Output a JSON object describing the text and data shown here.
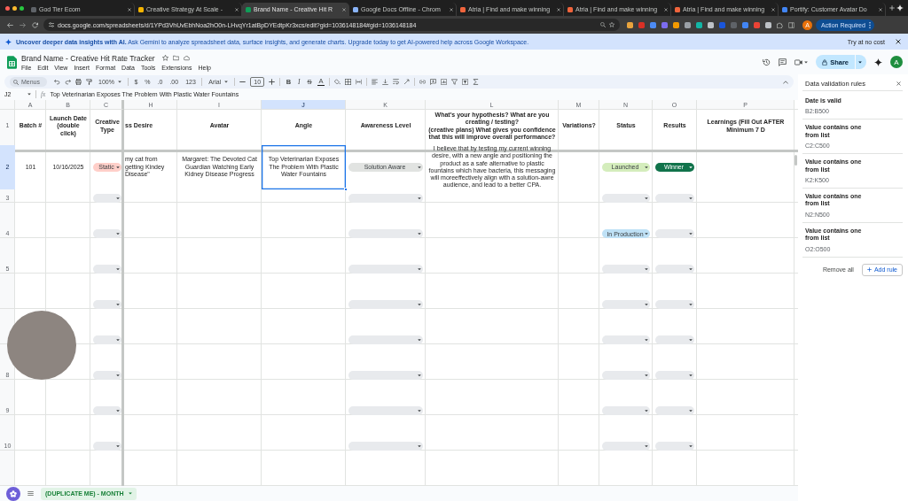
{
  "browser": {
    "tabs": [
      {
        "title": "God Tier Ecom",
        "color": "#5f6368",
        "selected": false
      },
      {
        "title": "Creative Strategy At Scale -",
        "color": "#f4b400",
        "selected": false
      },
      {
        "title": "Brand Name - Creative Hit R",
        "color": "#0f9d58",
        "selected": true
      },
      {
        "title": "Google Docs Offline - Chrom",
        "color": "#8ab4f8",
        "selected": false
      },
      {
        "title": "Atria | Find and make winning",
        "color": "#f0643c",
        "selected": false
      },
      {
        "title": "Atria | Find and make winning",
        "color": "#f0643c",
        "selected": false
      },
      {
        "title": "Atria | Find and make winning",
        "color": "#f0643c",
        "selected": false
      },
      {
        "title": "Portify: Customer Avatar Do",
        "color": "#4285f4",
        "selected": false
      }
    ],
    "url": "docs.google.com/spreadsheets/d/1YPd3VhUvEbhNoa2hO0n-LHvqYr1atBpDYEdtpKr3xcs/edit?gid=1036148184#gid=1036148184",
    "profile": "A",
    "action": "Action Required"
  },
  "banner": {
    "message": "**Uncover deeper data insights with AI.**  Ask Gemini to analyze spreadsheet data, surface insights, and generate charts. Upgrade today to get AI-powered help across Google Workspace.",
    "link": "Try at no cost"
  },
  "document": {
    "title": "Brand Name - Creative Hit Rate Tracker",
    "menu": [
      "File",
      "Edit",
      "View",
      "Insert",
      "Format",
      "Data",
      "Tools",
      "Extensions",
      "Help"
    ],
    "share": "Share",
    "avatar": "A"
  },
  "toolbar": [
    {
      "kind": "search",
      "label": "Menus"
    },
    {
      "kind": "undo"
    },
    {
      "kind": "redo"
    },
    {
      "kind": "print"
    },
    {
      "kind": "paint-format"
    },
    {
      "kind": "dropdown",
      "label": "100%"
    },
    {
      "kind": "separator"
    },
    {
      "kind": "text",
      "label": "$"
    },
    {
      "kind": "text",
      "label": "%"
    },
    {
      "kind": "text",
      "label": ".0"
    },
    {
      "kind": "text",
      "label": ".00"
    },
    {
      "kind": "text",
      "label": "123"
    },
    {
      "kind": "separator"
    },
    {
      "kind": "dropdown",
      "label": "Arial"
    },
    {
      "kind": "separator"
    },
    {
      "kind": "minus"
    },
    {
      "kind": "field",
      "value": "10"
    },
    {
      "kind": "plus"
    },
    {
      "kind": "separator"
    },
    {
      "kind": "bold",
      "label": "B"
    },
    {
      "kind": "italic",
      "label": "I"
    },
    {
      "kind": "strike",
      "label": "S"
    },
    {
      "kind": "text-color",
      "label": "A"
    },
    {
      "kind": "separator"
    },
    {
      "kind": "fill"
    },
    {
      "kind": "borders"
    },
    {
      "kind": "merge"
    },
    {
      "kind": "separator"
    },
    {
      "kind": "align"
    },
    {
      "kind": "valign"
    },
    {
      "kind": "wrap"
    },
    {
      "kind": "rotate"
    },
    {
      "kind": "separator"
    },
    {
      "kind": "link"
    },
    {
      "kind": "comment"
    },
    {
      "kind": "chart"
    },
    {
      "kind": "filter"
    },
    {
      "kind": "filter-views"
    },
    {
      "kind": "functions"
    }
  ],
  "formula_bar": {
    "cell": "J2",
    "function_label": "fx",
    "formula": "Top Veterinarian Exposes The Problem With Plastic Water Fountains"
  },
  "sheet": {
    "columns": [
      {
        "letter": "A",
        "selected": false
      },
      {
        "letter": "B",
        "selected": false
      },
      {
        "letter": "C",
        "selected": false
      },
      {
        "letter": "H",
        "selected": false
      },
      {
        "letter": "I",
        "selected": false
      },
      {
        "letter": "J",
        "selected": true
      },
      {
        "letter": "K",
        "selected": false
      },
      {
        "letter": "L",
        "selected": false
      },
      {
        "letter": "M",
        "selected": false
      },
      {
        "letter": "N",
        "selected": false
      },
      {
        "letter": "O",
        "selected": false
      },
      {
        "letter": "P",
        "selected": false
      }
    ],
    "rows": [
      {
        "number": "1",
        "selected": false,
        "kind": "header",
        "cells": [
          {
            "kind": "text",
            "text": "Batch #"
          },
          {
            "kind": "text",
            "text": "Launch Date (double click)"
          },
          {
            "kind": "text",
            "text": "Creative Type"
          },
          {
            "kind": "text",
            "text": "ss Desire"
          },
          {
            "kind": "text",
            "text": "Avatar"
          },
          {
            "kind": "text",
            "text": "Angle"
          },
          {
            "kind": "text",
            "text": "Awareness Level"
          },
          {
            "kind": "text",
            "text": "What's your hypothesis? What are you creating / testing?\n(creative plans) What gives you confidence that this will improve overall performance?"
          },
          {
            "kind": "text",
            "text": "Variations?"
          },
          {
            "kind": "text",
            "text": "Status"
          },
          {
            "kind": "text",
            "text": "Results"
          },
          {
            "kind": "text",
            "text": "Learnings (Fill Out AFTER Minimum 7 D"
          }
        ]
      },
      {
        "number": "2",
        "selected": true,
        "kind": "data",
        "cells": [
          {
            "kind": "text",
            "text": "101"
          },
          {
            "kind": "text",
            "text": "10/16/2025"
          },
          {
            "kind": "chip",
            "label": "Static",
            "color": "#ffcfc9"
          },
          {
            "kind": "text",
            "text": "my cat from getting Kindey Disease\""
          },
          {
            "kind": "text",
            "text": "Margaret: The Devoted Cat Guardian Watching Early Kidney Disease Progress"
          },
          {
            "kind": "text",
            "text": "Top Veterinarian Exposes The Problem With Plastic Water Fountains"
          },
          {
            "kind": "chip",
            "label": "Solution Aware",
            "color": "#e1e3e1"
          },
          {
            "kind": "text",
            "text": "I believe that by testing my current winning desire, with a new angle and positioning the product as a safe alternative to plastic fountains which have bacteria, this messaging will moreeffectively align with a solution-awre audience, and lead to a better CPA."
          },
          {
            "kind": "empty"
          },
          {
            "kind": "chip",
            "label": "Launched",
            "color": "#d4edbc"
          },
          {
            "kind": "chip",
            "label": "Winner",
            "color": "#11734b"
          },
          {
            "kind": "empty"
          }
        ]
      },
      {
        "number": "3",
        "selected": false,
        "kind": "data",
        "cells": [
          {
            "kind": "empty"
          },
          {
            "kind": "empty"
          },
          {
            "kind": "chip",
            "color": "#e8eaed"
          },
          {
            "kind": "empty"
          },
          {
            "kind": "empty"
          },
          {
            "kind": "empty"
          },
          {
            "kind": "chip",
            "color": "#e8eaed"
          },
          {
            "kind": "empty"
          },
          {
            "kind": "empty"
          },
          {
            "kind": "chip",
            "color": "#e8eaed"
          },
          {
            "kind": "chip",
            "color": "#e8eaed"
          },
          {
            "kind": "empty"
          }
        ]
      },
      {
        "number": "4",
        "selected": false,
        "kind": "data",
        "cells": [
          {
            "kind": "empty"
          },
          {
            "kind": "empty"
          },
          {
            "kind": "chip",
            "color": "#e8eaed"
          },
          {
            "kind": "empty"
          },
          {
            "kind": "empty"
          },
          {
            "kind": "empty"
          },
          {
            "kind": "chip",
            "color": "#e8eaed"
          },
          {
            "kind": "empty"
          },
          {
            "kind": "empty"
          },
          {
            "kind": "chip",
            "label": "In Production",
            "color": "#bfe1f6"
          },
          {
            "kind": "chip",
            "color": "#e8eaed"
          },
          {
            "kind": "empty"
          }
        ]
      },
      {
        "number": "5",
        "selected": false,
        "kind": "data",
        "cells": [
          {
            "kind": "empty"
          },
          {
            "kind": "empty"
          },
          {
            "kind": "chip",
            "color": "#e8eaed"
          },
          {
            "kind": "empty"
          },
          {
            "kind": "empty"
          },
          {
            "kind": "empty"
          },
          {
            "kind": "chip",
            "color": "#e8eaed"
          },
          {
            "kind": "empty"
          },
          {
            "kind": "empty"
          },
          {
            "kind": "chip",
            "color": "#e8eaed"
          },
          {
            "kind": "chip",
            "color": "#e8eaed"
          },
          {
            "kind": "empty"
          }
        ]
      },
      {
        "selected": false,
        "kind": "data",
        "cells": [
          {
            "kind": "empty"
          },
          {
            "kind": "empty"
          },
          {
            "kind": "chip",
            "color": "#e8eaed"
          },
          {
            "kind": "empty"
          },
          {
            "kind": "empty"
          },
          {
            "kind": "empty"
          },
          {
            "kind": "chip",
            "color": "#e8eaed"
          },
          {
            "kind": "empty"
          },
          {
            "kind": "empty"
          },
          {
            "kind": "chip",
            "color": "#e8eaed"
          },
          {
            "kind": "chip",
            "color": "#e8eaed"
          },
          {
            "kind": "empty"
          }
        ]
      },
      {
        "selected": false,
        "kind": "data",
        "cells": [
          {
            "kind": "empty"
          },
          {
            "kind": "empty"
          },
          {
            "kind": "chip",
            "color": "#e8eaed"
          },
          {
            "kind": "empty"
          },
          {
            "kind": "empty"
          },
          {
            "kind": "empty"
          },
          {
            "kind": "chip",
            "color": "#e8eaed"
          },
          {
            "kind": "empty"
          },
          {
            "kind": "empty"
          },
          {
            "kind": "chip",
            "color": "#e8eaed"
          },
          {
            "kind": "chip",
            "color": "#e8eaed"
          },
          {
            "kind": "empty"
          }
        ]
      },
      {
        "number": "8",
        "selected": false,
        "kind": "data",
        "cells": [
          {
            "kind": "empty"
          },
          {
            "kind": "empty"
          },
          {
            "kind": "chip",
            "color": "#e8eaed"
          },
          {
            "kind": "empty"
          },
          {
            "kind": "empty"
          },
          {
            "kind": "empty"
          },
          {
            "kind": "chip",
            "color": "#e8eaed"
          },
          {
            "kind": "empty"
          },
          {
            "kind": "empty"
          },
          {
            "kind": "chip",
            "color": "#e8eaed"
          },
          {
            "kind": "chip",
            "color": "#e8eaed"
          },
          {
            "kind": "empty"
          }
        ]
      },
      {
        "number": "9",
        "selected": false,
        "kind": "data",
        "cells": [
          {
            "kind": "empty"
          },
          {
            "kind": "empty"
          },
          {
            "kind": "chip",
            "color": "#e8eaed"
          },
          {
            "kind": "empty"
          },
          {
            "kind": "empty"
          },
          {
            "kind": "empty"
          },
          {
            "kind": "chip",
            "color": "#e8eaed"
          },
          {
            "kind": "empty"
          },
          {
            "kind": "empty"
          },
          {
            "kind": "chip",
            "color": "#e8eaed"
          },
          {
            "kind": "chip",
            "color": "#e8eaed"
          },
          {
            "kind": "empty"
          }
        ]
      },
      {
        "number": "10",
        "selected": false,
        "kind": "data",
        "cells": [
          {
            "kind": "empty"
          },
          {
            "kind": "empty"
          },
          {
            "kind": "chip",
            "color": "#e8eaed"
          },
          {
            "kind": "empty"
          },
          {
            "kind": "empty"
          },
          {
            "kind": "empty"
          },
          {
            "kind": "chip",
            "color": "#e8eaed"
          },
          {
            "kind": "empty"
          },
          {
            "kind": "empty"
          },
          {
            "kind": "chip",
            "color": "#e8eaed"
          },
          {
            "kind": "chip",
            "color": "#e8eaed"
          },
          {
            "kind": "empty"
          }
        ]
      }
    ]
  },
  "sheet_tabs": [
    {
      "label": "(DUPLICATE ME) - MONTH",
      "selected": true
    }
  ],
  "panel": {
    "title": "Data validation rules",
    "rules": [
      {
        "condition": "Date is valid",
        "range": "B2:B500"
      },
      {
        "condition": "Value contains one from list",
        "range": "C2:C500"
      },
      {
        "condition": "Value contains one from list",
        "range": "K2:K500"
      },
      {
        "condition": "Value contains one from list",
        "range": "N2:N500"
      },
      {
        "condition": "Value contains one from list",
        "range": "O2:O500"
      }
    ],
    "buttons": [
      {
        "kind": "remove-all",
        "label": "Remove all"
      },
      {
        "kind": "add",
        "label": "Add rule"
      }
    ]
  },
  "camera_bubble": {
    "shown": true
  }
}
